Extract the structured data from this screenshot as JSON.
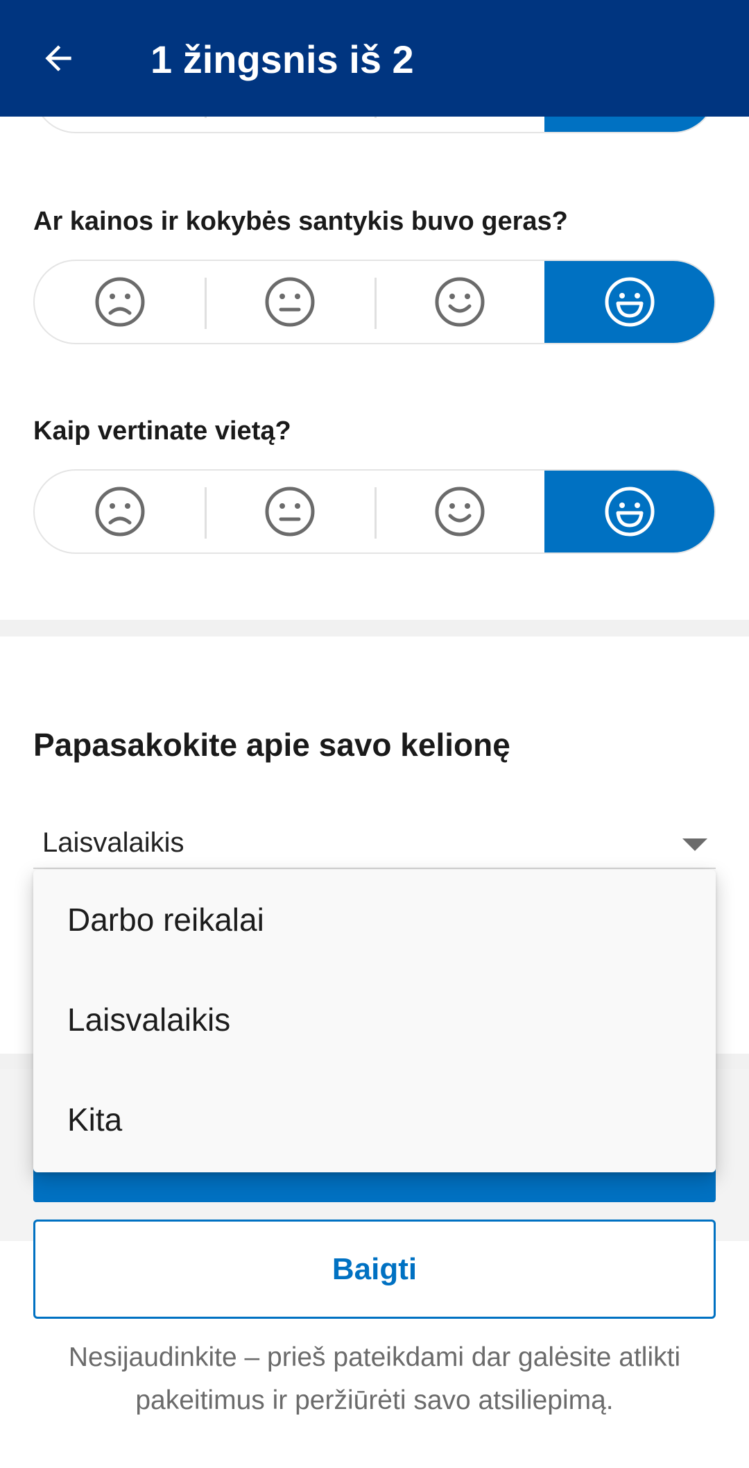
{
  "header": {
    "back_icon": "arrow-left-icon",
    "title": "1 žingsnis iš 2"
  },
  "questions": [
    {
      "text": "Ar kainos ir kokybės santykis buvo geras?",
      "selected": "very-happy"
    },
    {
      "text": "Kaip vertinate vietą?",
      "selected": "very-happy"
    }
  ],
  "rating_scale": [
    "sad-face-icon",
    "neutral-face-icon",
    "smile-face-icon",
    "big-smile-face-icon"
  ],
  "trip": {
    "title": "Papasakokite apie savo kelionę",
    "select_value": "Laisvalaikis",
    "options": [
      "Darbo reikalai",
      "Laisvalaikis",
      "Kita"
    ]
  },
  "actions": {
    "finish_label": "Baigti"
  },
  "footer": {
    "note": "Nesijaudinkite – prieš pateikdami dar galėsite atlikti pakeitimus ir peržiūrėti savo atsiliepimą."
  },
  "colors": {
    "header_bg": "#003580",
    "accent": "#0071c2"
  }
}
